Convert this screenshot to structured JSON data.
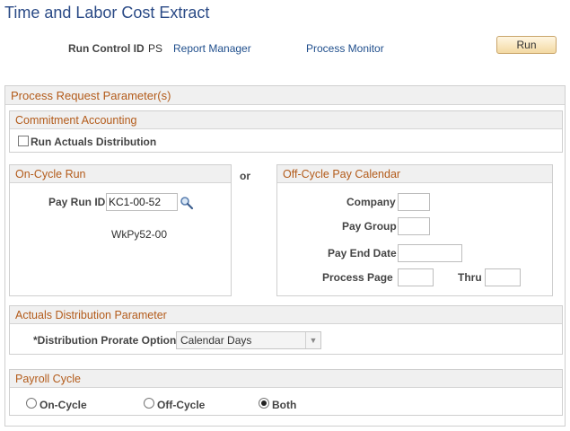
{
  "page": {
    "title": "Time and Labor Cost Extract"
  },
  "toolbar": {
    "run_control_label": "Run Control ID",
    "run_control_value": "PS",
    "report_manager": "Report Manager",
    "process_monitor": "Process Monitor",
    "run_button": "Run"
  },
  "process_request": {
    "header": "Process Request Parameter(s)"
  },
  "commitment": {
    "header": "Commitment Accounting",
    "checkbox_label": "Run Actuals Distribution",
    "checked": false
  },
  "on_cycle": {
    "header": "On-Cycle Run",
    "pay_run_label": "Pay Run ID",
    "pay_run_value": "KC1-00-52",
    "description": "WkPy52-00",
    "search_icon": "search-icon"
  },
  "or_text": "or",
  "off_cycle": {
    "header": "Off-Cycle Pay Calendar",
    "company_label": "Company",
    "company_value": "",
    "pay_group_label": "Pay Group",
    "pay_group_value": "",
    "pay_end_label": "Pay End Date",
    "pay_end_value": "",
    "process_page_label": "Process Page",
    "process_page_value": "",
    "thru_label": "Thru",
    "thru_value": ""
  },
  "actuals": {
    "header": "Actuals Distribution Parameter",
    "prorate_label": "*Distribution Prorate Option",
    "prorate_value": "Calendar Days"
  },
  "payroll_cycle": {
    "header": "Payroll Cycle",
    "options": [
      "On-Cycle",
      "Off-Cycle",
      "Both"
    ],
    "selected": "Both"
  }
}
